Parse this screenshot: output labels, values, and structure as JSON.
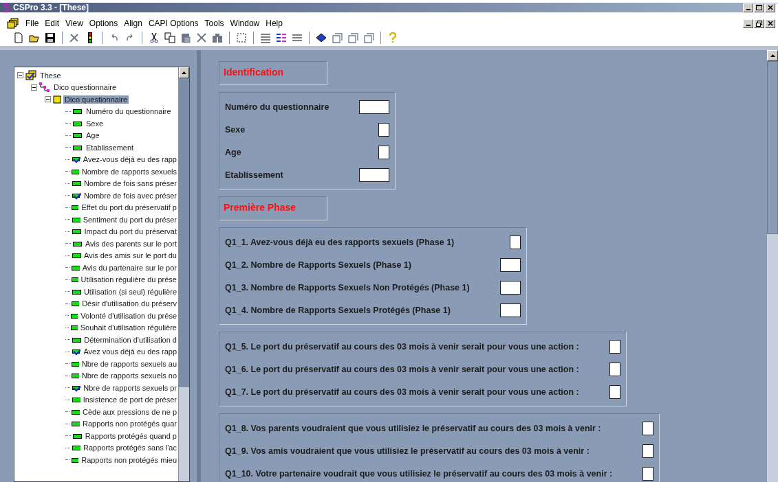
{
  "window": {
    "title": "CSPro 3.3 - [These]"
  },
  "menu": [
    "File",
    "Edit",
    "View",
    "Options",
    "Align",
    "CAPI Options",
    "Tools",
    "Window",
    "Help"
  ],
  "tree": {
    "label": "These",
    "expanded": true,
    "children": [
      {
        "label": "Dico questionnaire",
        "expanded": true,
        "children": [
          {
            "label": "Dico questionnaire",
            "expanded": true,
            "selected": true,
            "items": [
              {
                "label": "Numéro du questionnaire",
                "kind": "field"
              },
              {
                "label": "Sexe",
                "kind": "field"
              },
              {
                "label": "Age",
                "kind": "field"
              },
              {
                "label": "Etablissement",
                "kind": "field"
              },
              {
                "label": "Avez-vous déjà eu des rapp",
                "kind": "check"
              },
              {
                "label": "Nombre de rapports sexuels",
                "kind": "field"
              },
              {
                "label": "Nombre de fois sans préser",
                "kind": "field"
              },
              {
                "label": "Nombre de fois avec préser",
                "kind": "check"
              },
              {
                "label": "Effet du port du préservatif p",
                "kind": "field"
              },
              {
                "label": "Sentiment du port du préser",
                "kind": "field"
              },
              {
                "label": "Impact du port du préservat",
                "kind": "field"
              },
              {
                "label": "Avis des parents sur le port",
                "kind": "field"
              },
              {
                "label": "Avis des amis sur le port du",
                "kind": "field"
              },
              {
                "label": "Avis du partenaire sur le por",
                "kind": "field"
              },
              {
                "label": "Utilisation régulière du prése",
                "kind": "field"
              },
              {
                "label": "Utilisation (si seul) régulière",
                "kind": "field"
              },
              {
                "label": "Désir d'utilisation du préserv",
                "kind": "field"
              },
              {
                "label": "Volonté d'utilisation du prése",
                "kind": "field"
              },
              {
                "label": "Souhait d'utilisation régulière",
                "kind": "field"
              },
              {
                "label": "Détermination d'utilisation d",
                "kind": "field"
              },
              {
                "label": "Avez vous déjà eu des rapp",
                "kind": "check"
              },
              {
                "label": "Nbre de rapports sexuels au",
                "kind": "field"
              },
              {
                "label": "Nbre de rapports sexuels no",
                "kind": "field"
              },
              {
                "label": "Nbre de rapports sexuels pr",
                "kind": "check"
              },
              {
                "label": "Insistence de port de préser",
                "kind": "field"
              },
              {
                "label": "Cède aux pressions de ne p",
                "kind": "field"
              },
              {
                "label": "Rapports non protégés quar",
                "kind": "field"
              },
              {
                "label": "Rapports protégés quand p",
                "kind": "field"
              },
              {
                "label": "Rapports protégés sans l'ac",
                "kind": "field"
              },
              {
                "label": "Rapports non protégés mieu",
                "kind": "field"
              }
            ]
          }
        ]
      }
    ]
  },
  "form": [
    {
      "kind": "heading",
      "text": "Identification"
    },
    {
      "kind": "group",
      "fields": [
        {
          "label": "Numéro du questionnaire",
          "kind": "wide"
        },
        {
          "label": "Sexe",
          "kind": "narrow"
        },
        {
          "label": "Age",
          "kind": "narrow"
        },
        {
          "label": "Etablissement",
          "kind": "wide"
        }
      ]
    },
    {
      "kind": "heading",
      "text": "Première Phase"
    },
    {
      "kind": "group",
      "fields": [
        {
          "label": "Q1_1. Avez-vous déjà eu des rapports sexuels (Phase 1)",
          "kind": "narrow"
        },
        {
          "label": "Q1_2. Nombre de Rapports Sexuels (Phase 1)",
          "kind": "medium"
        },
        {
          "label": "Q1_3. Nombre de Rapports Sexuels Non Protégés (Phase 1)",
          "kind": "medium"
        },
        {
          "label": "Q1_4. Nombre de Rapports Sexuels Protégés (Phase 1)",
          "kind": "medium"
        }
      ]
    },
    {
      "kind": "group",
      "fields": [
        {
          "label": "Q1_5. Le port du préservatif au cours des 03 mois à venir serait pour vous une action :",
          "kind": "narrow"
        },
        {
          "label": "Q1_6. Le port du préservatif au cours des 03 mois à venir serait pour vous une action :",
          "kind": "narrow"
        },
        {
          "label": "Q1_7. Le port du préservatif au cours des 03 mois à venir serait pour vous une action :",
          "kind": "narrow"
        }
      ]
    },
    {
      "kind": "group",
      "fields": [
        {
          "label": "Q1_8. Vos parents voudraient que vous utilisiez le préservatif au cours des 03 mois à venir :",
          "kind": "narrow"
        },
        {
          "label": "Q1_9. Vos amis voudraient que vous utilisiez le préservatif au cours des 03 mois à venir :",
          "kind": "narrow"
        },
        {
          "label": "Q1_10. Votre partenaire voudrait que vous utilisiez le préservatif au cours des 03 mois à venir :",
          "kind": "narrow"
        }
      ]
    }
  ]
}
